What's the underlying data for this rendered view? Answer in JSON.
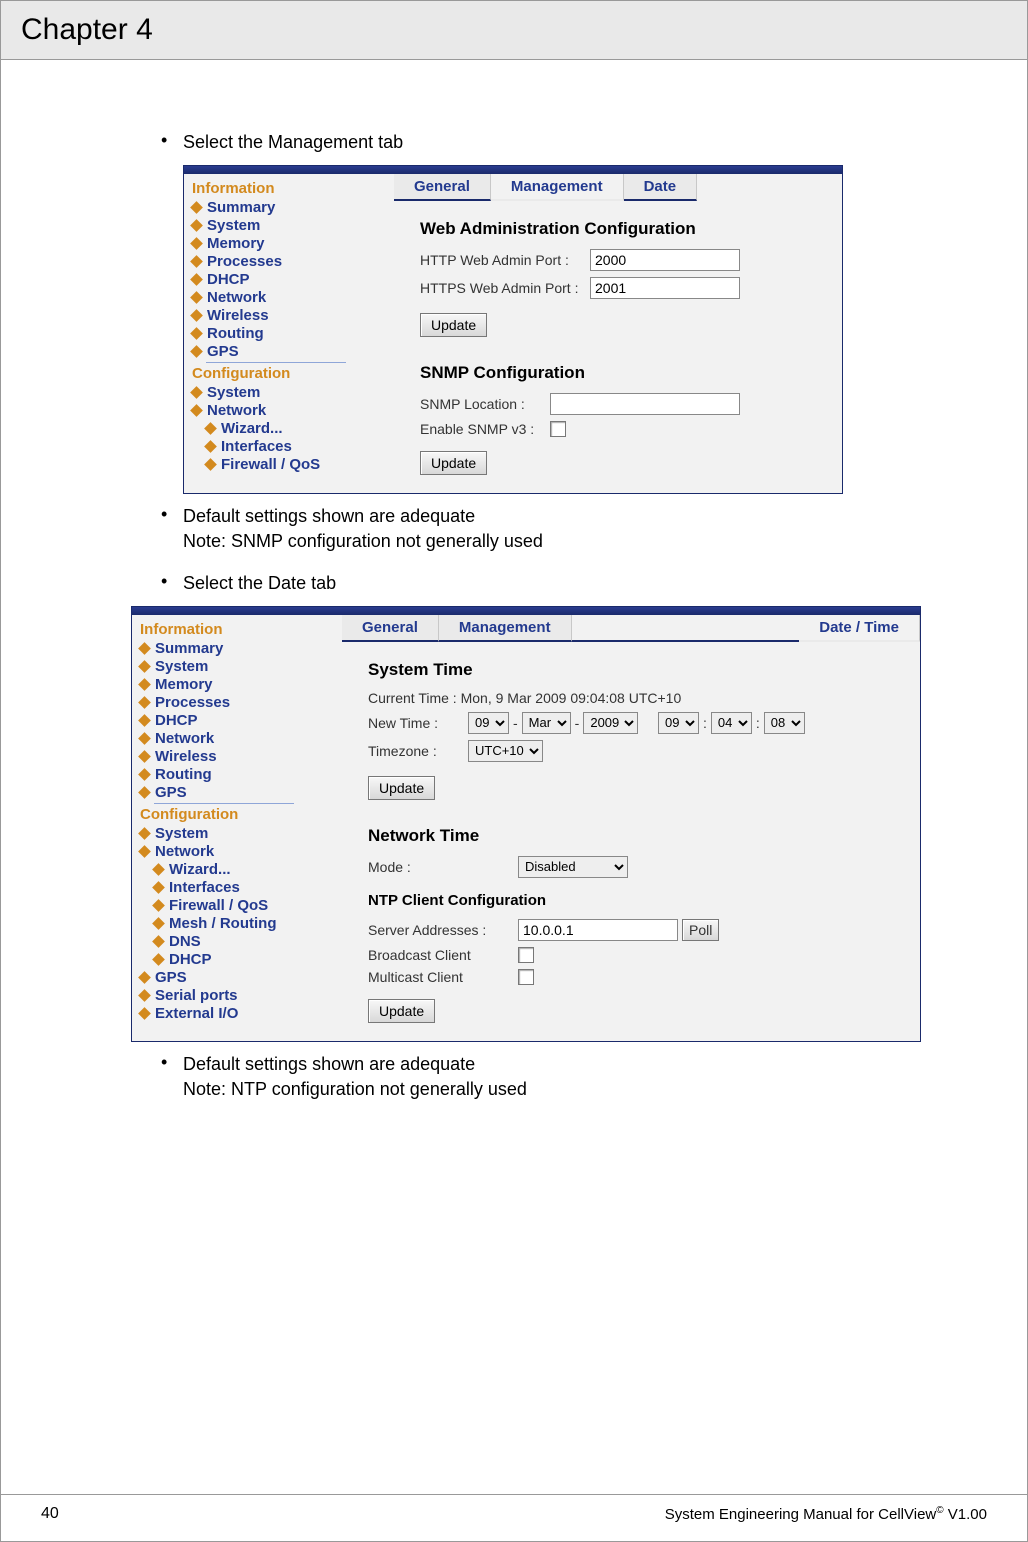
{
  "header": {
    "chapter": "Chapter 4"
  },
  "bullets": {
    "b1": "Select the Management tab",
    "b2a": "Default settings shown are adequate",
    "b2b": "Note: SNMP configuration not generally used",
    "b3": "Select the Date tab",
    "b4a": "Default settings shown are adequate",
    "b4b": "Note: NTP configuration not generally used"
  },
  "ss1": {
    "sidebar": {
      "section1": "Information",
      "items1": [
        "Summary",
        "System",
        "Memory",
        "Processes",
        "DHCP",
        "Network",
        "Wireless",
        "Routing",
        "GPS"
      ],
      "section2": "Configuration",
      "items2": [
        "System",
        "Network"
      ],
      "items2sub": [
        "Wizard...",
        "Interfaces",
        "Firewall / QoS"
      ]
    },
    "tabs": {
      "general": "General",
      "management": "Management",
      "date": "Date"
    },
    "web": {
      "title": "Web Administration Configuration",
      "http_label": "HTTP Web Admin Port :",
      "http_value": "2000",
      "https_label": "HTTPS Web Admin Port :",
      "https_value": "2001",
      "update": "Update"
    },
    "snmp": {
      "title": "SNMP Configuration",
      "loc_label": "SNMP Location :",
      "loc_value": "",
      "v3_label": "Enable SNMP v3 :",
      "update": "Update"
    }
  },
  "ss2": {
    "sidebar": {
      "section1": "Information",
      "items1": [
        "Summary",
        "System",
        "Memory",
        "Processes",
        "DHCP",
        "Network",
        "Wireless",
        "Routing",
        "GPS"
      ],
      "section2": "Configuration",
      "items2": [
        "System",
        "Network"
      ],
      "items2sub": [
        "Wizard...",
        "Interfaces",
        "Firewall / QoS",
        "Mesh / Routing",
        "DNS",
        "DHCP"
      ],
      "items3": [
        "GPS",
        "Serial ports",
        "External I/O"
      ]
    },
    "tabs": {
      "general": "General",
      "management": "Management",
      "date": "Date / Time"
    },
    "systime": {
      "title": "System Time",
      "current_label": "Current Time :",
      "current_value": "Mon, 9 Mar 2009 09:04:08 UTC+10",
      "newtime_label": "New Time :",
      "day": "09",
      "month": "Mar",
      "year": "2009",
      "hour": "09",
      "min": "04",
      "sec": "08",
      "tz_label": "Timezone :",
      "tz_value": "UTC+10",
      "update": "Update"
    },
    "nettime": {
      "title": "Network Time",
      "mode_label": "Mode :",
      "mode_value": "Disabled",
      "ntp_title": "NTP Client Configuration",
      "server_label": "Server Addresses :",
      "server_value": "10.0.0.1",
      "poll": "Poll",
      "bcast_label": "Broadcast Client",
      "mcast_label": "Multicast Client",
      "update": "Update"
    }
  },
  "footer": {
    "pagenum": "40",
    "doc_pre": "System Engineering Manual for CellView",
    "doc_sup": "©",
    "doc_post": " V1.00"
  }
}
